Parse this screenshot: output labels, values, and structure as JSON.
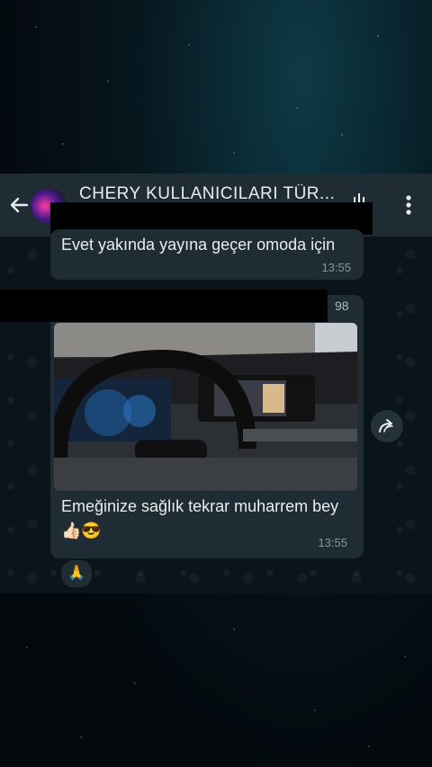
{
  "chat": {
    "title": "CHERY KULLANICILARI TÜR..."
  },
  "messages": [
    {
      "text": "Evet yakında yayına geçer omoda için",
      "time": "13:55"
    },
    {
      "sender_suffix": "98",
      "text": "Emeğinize sağlık tekrar muharrem bey👍🏻😎",
      "time": "13:55",
      "reaction": "🙏"
    }
  ],
  "icons": [
    "back-arrow-icon",
    "call-icon",
    "more-vert-icon",
    "forward-icon"
  ],
  "colors": {
    "header": "#1f2c33",
    "bubble": "#1f2c33",
    "chat_bg": "#0b141a",
    "time": "#8696a0"
  }
}
